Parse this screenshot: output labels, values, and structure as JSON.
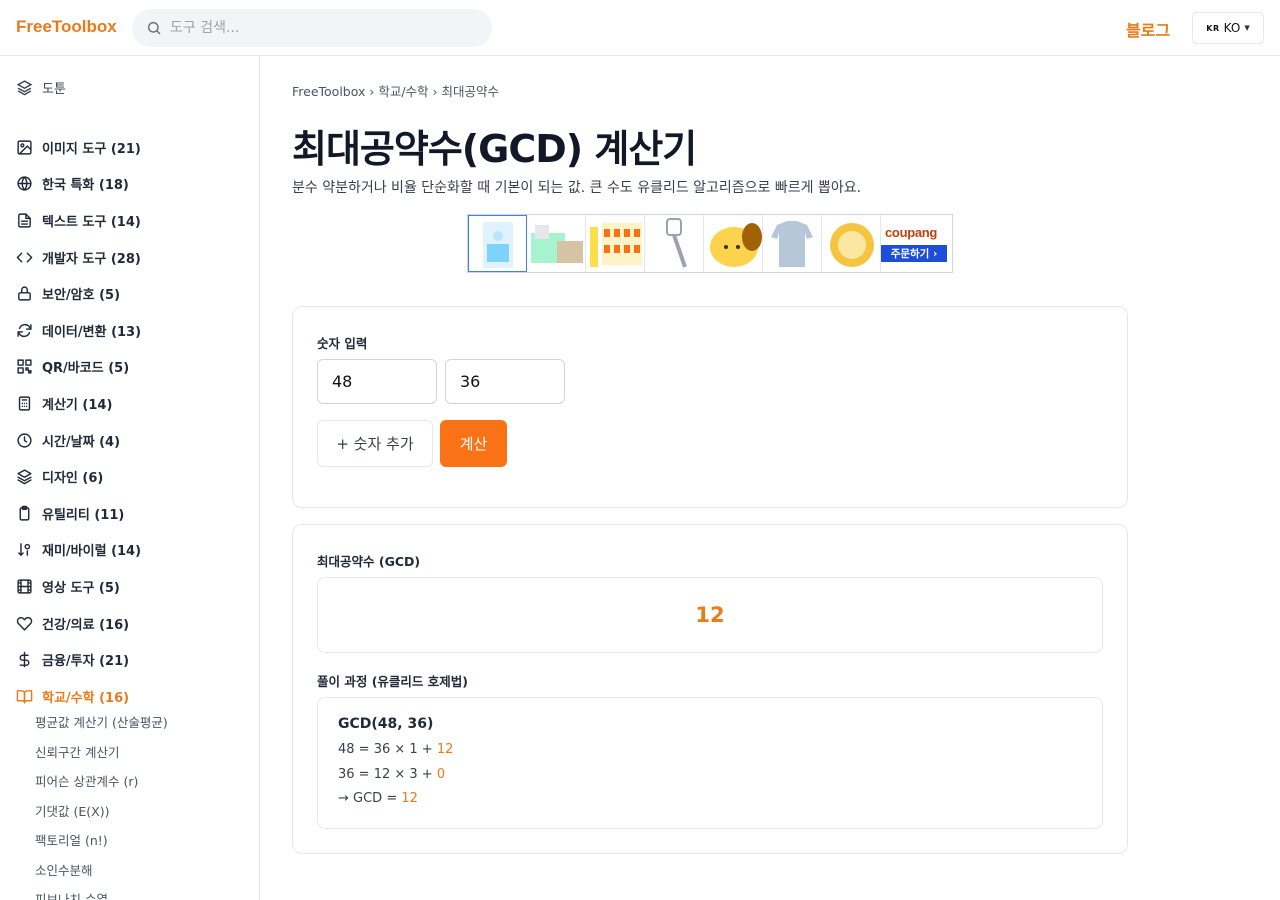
{
  "header": {
    "logo": "FreeToolbox",
    "search_placeholder": "도구 검색...",
    "blog": "블로그",
    "lang_flag": "KR",
    "lang": "KO"
  },
  "sidebar": {
    "top": "도툰",
    "categories": [
      {
        "label": "이미지 도구 (21)",
        "icon": "image-icon"
      },
      {
        "label": "한국 특화 (18)",
        "icon": "globe-icon"
      },
      {
        "label": "텍스트 도구 (14)",
        "icon": "file-text-icon"
      },
      {
        "label": "개발자 도구 (28)",
        "icon": "code-icon"
      },
      {
        "label": "보안/암호 (5)",
        "icon": "lock-icon"
      },
      {
        "label": "데이터/변환 (13)",
        "icon": "refresh-icon"
      },
      {
        "label": "QR/바코드 (5)",
        "icon": "qr-icon"
      },
      {
        "label": "계산기 (14)",
        "icon": "calculator-icon"
      },
      {
        "label": "시간/날짜 (4)",
        "icon": "clock-icon"
      },
      {
        "label": "디자인 (6)",
        "icon": "layers-icon"
      },
      {
        "label": "유틸리티 (11)",
        "icon": "clipboard-icon"
      },
      {
        "label": "재미/바이럴 (14)",
        "icon": "sort-icon"
      },
      {
        "label": "영상 도구 (5)",
        "icon": "film-icon"
      },
      {
        "label": "건강/의료 (16)",
        "icon": "heart-icon"
      },
      {
        "label": "금융/투자 (21)",
        "icon": "dollar-icon"
      },
      {
        "label": "학교/수학 (16)",
        "icon": "book-icon"
      }
    ],
    "subitems": [
      "평균값 계산기 (산술평균)",
      "신뢰구간 계산기",
      "피어슨 상관계수 (r)",
      "기댓값 (E(X))",
      "팩토리얼 (n!)",
      "소인수분해",
      "피보나치 수열"
    ]
  },
  "breadcrumb": "FreeToolbox › 학교/수학 › 최대공약수",
  "title": "최대공약수(GCD) 계산기",
  "description": "분수 약분하거나 비율 단순화할 때 기본이 되는 값. 큰 수도 유클리드 알고리즘으로 빠르게 뽑아요.",
  "ad": {
    "logo": "coupang",
    "order": "주문하기 ›"
  },
  "input_card": {
    "label": "숫자 입력",
    "values": [
      "48",
      "36"
    ],
    "add_button": "+ 숫자 추가",
    "calc_button": "계산"
  },
  "result_card": {
    "label": "최대공약수 (GCD)",
    "value": "12",
    "steps_label": "풀이 과정 (유클리드 호제법)",
    "step_head": "GCD(48, 36)",
    "steps": [
      {
        "text": "48 = 36 × 1 + ",
        "rem": "12"
      },
      {
        "text": "36 = 12 × 3 + ",
        "rem": "0"
      },
      {
        "text": "→ GCD = ",
        "rem": "12"
      }
    ]
  },
  "colors": {
    "accent": "#f97316",
    "accent_text": "#ea7a1a"
  }
}
